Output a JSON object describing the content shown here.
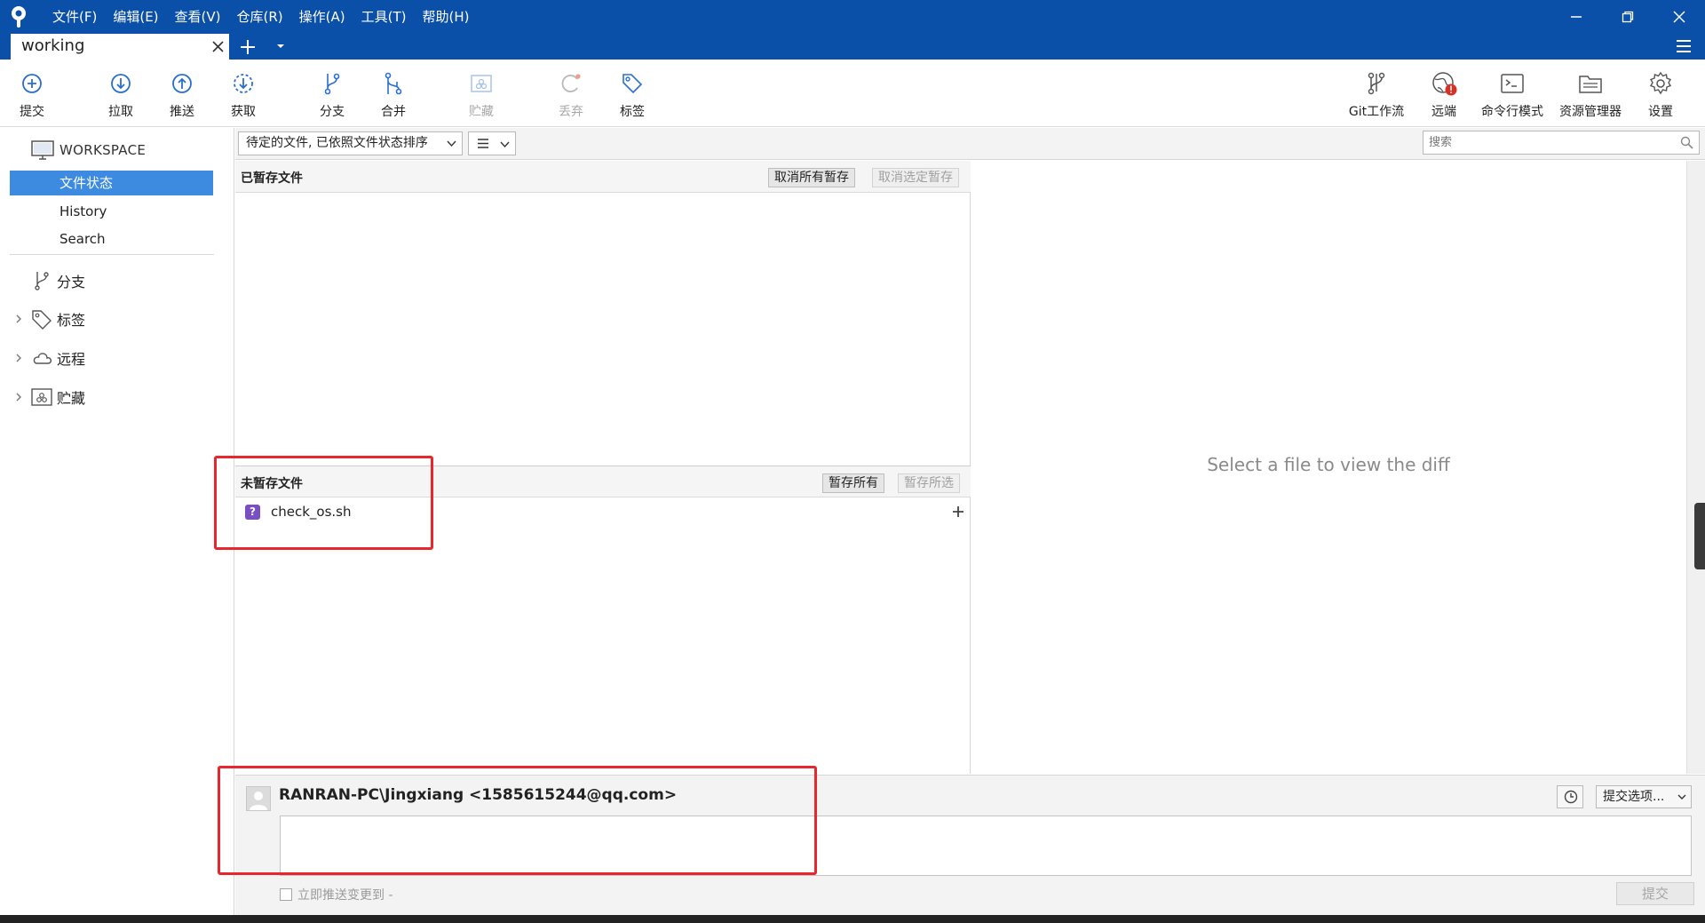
{
  "menu": [
    "文件(F)",
    "编辑(E)",
    "查看(V)",
    "仓库(R)",
    "操作(A)",
    "工具(T)",
    "帮助(H)"
  ],
  "tab": {
    "title": "working"
  },
  "toolbar": {
    "commit": "提交",
    "pull": "拉取",
    "push": "推送",
    "fetch": "获取",
    "branch": "分支",
    "merge": "合并",
    "stash": "贮藏",
    "discard": "丢弃",
    "tag": "标签",
    "gitflow": "Git工作流",
    "remote": "远端",
    "terminal": "命令行模式",
    "explorer": "资源管理器",
    "settings": "设置"
  },
  "sidebar": {
    "workspace": "WORKSPACE",
    "items": [
      "文件状态",
      "History",
      "Search"
    ],
    "groups": [
      "分支",
      "标签",
      "远程",
      "贮藏"
    ]
  },
  "filter": {
    "sort_label": "待定的文件, 已依照文件状态排序",
    "search_placeholder": "搜索"
  },
  "staged": {
    "title": "已暂存文件",
    "unstage_all": "取消所有暂存",
    "unstage_selected": "取消选定暂存"
  },
  "unstaged": {
    "title": "未暂存文件",
    "stage_all": "暂存所有",
    "stage_selected": "暂存所选",
    "files": [
      {
        "status": "?",
        "name": "check_os.sh"
      }
    ]
  },
  "diff": {
    "empty_message": "Select a file to view the diff"
  },
  "commit": {
    "author": "RANRAN-PC\\Jingxiang <1585615244@qq.com>",
    "options_label": "提交选项...",
    "push_label": "立即推送变更到 -",
    "submit_label": "提交"
  },
  "colors": {
    "titlebar": "#0a4fa8",
    "selection": "#3d8be0",
    "annotation": "#e8262e",
    "badge": "#7a4fc4"
  }
}
